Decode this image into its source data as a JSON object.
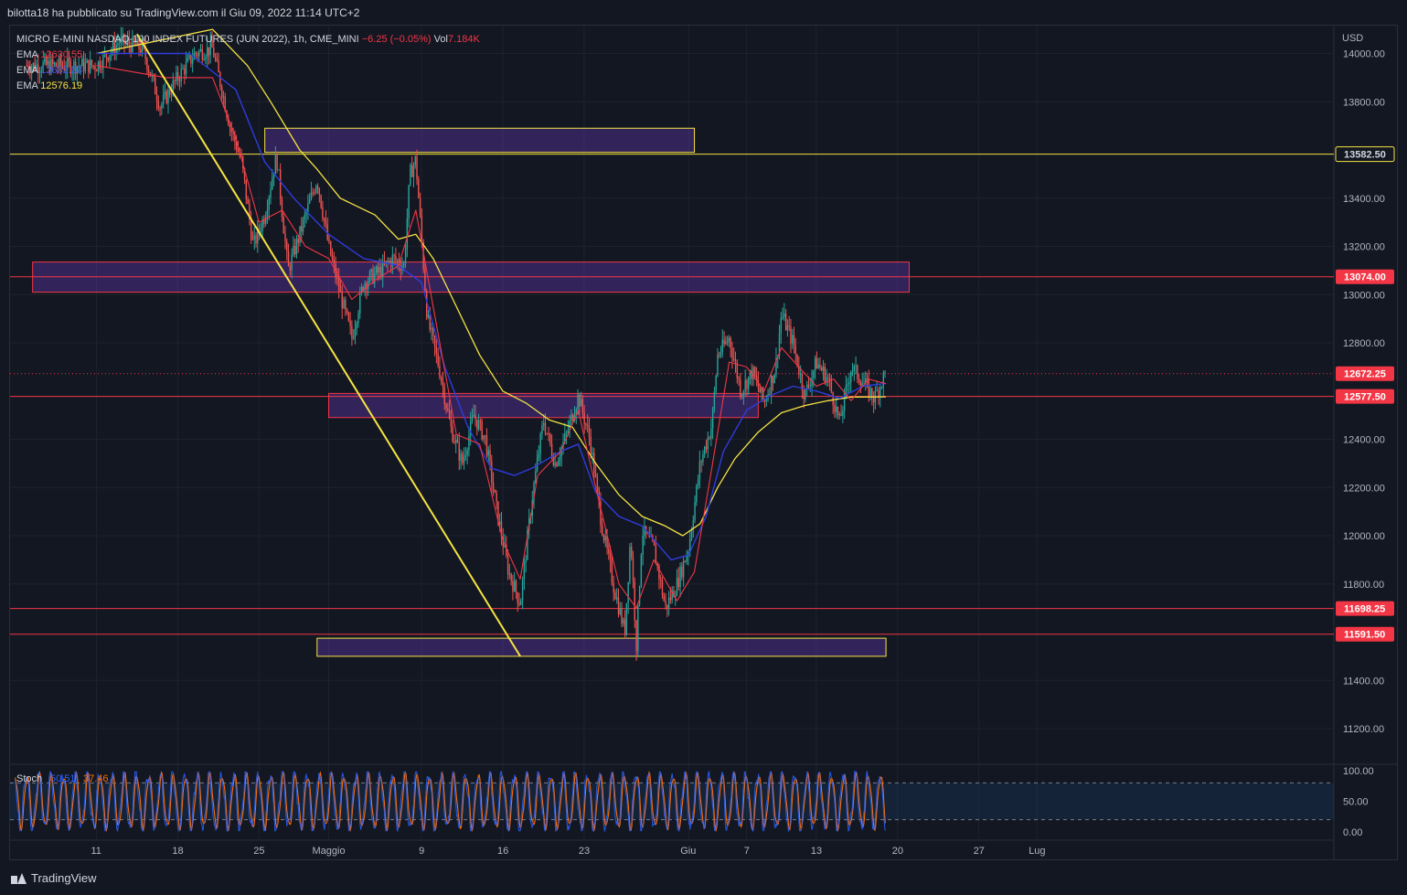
{
  "header": {
    "published_line": "bilotta18 ha pubblicato su TradingView.com il Giu 09, 2022 11:14 UTC+2"
  },
  "legend": {
    "symbol": "MICRO E-MINI NASDAQ-100 INDEX FUTURES (JUN 2022), 1h, CME_MINI",
    "change": "−6.25 (−0.05%)",
    "volume_label": "Vol",
    "volume_value": "7.184K",
    "ema": [
      {
        "label": "EMA",
        "value": "12630.55",
        "color": "#f23645"
      },
      {
        "label": "EMA",
        "value": "12632.03",
        "color": "#2f3cdc"
      },
      {
        "label": "EMA",
        "value": "12576.19",
        "color": "#f5e342"
      }
    ]
  },
  "footer": {
    "brand": "TradingView"
  },
  "chart_data": [
    {
      "type": "candlestick",
      "currency": "USD",
      "ylim": [
        11050,
        14080
      ],
      "yticks": [
        14000,
        13800,
        13400,
        13200,
        13000,
        12800,
        12400,
        12200,
        12000,
        11800,
        11400,
        11200
      ],
      "ytick_labels": [
        "14000.00",
        "13800.00",
        "13400.00",
        "13200.00",
        "13000.00",
        "12800.00",
        "12400.00",
        "12200.00",
        "12000.00",
        "11800.00",
        "11400.00",
        "11200.00"
      ],
      "xticks": [
        {
          "label": "11",
          "pos": 0.0
        },
        {
          "label": "18",
          "pos": 7.0
        },
        {
          "label": "25",
          "pos": 14.0
        },
        {
          "label": "Maggio",
          "pos": 20.0
        },
        {
          "label": "9",
          "pos": 28.0
        },
        {
          "label": "16",
          "pos": 35.0
        },
        {
          "label": "23",
          "pos": 42.0
        },
        {
          "label": "Giu",
          "pos": 51.0
        },
        {
          "label": "7",
          "pos": 56.0
        },
        {
          "label": "13",
          "pos": 62.0
        },
        {
          "label": "20",
          "pos": 69.0
        },
        {
          "label": "27",
          "pos": 76.0
        },
        {
          "label": "Lug",
          "pos": 81.0
        }
      ],
      "price_path": [
        [
          0,
          13950
        ],
        [
          2,
          14050
        ],
        [
          4,
          14020
        ],
        [
          5.5,
          13780
        ],
        [
          7,
          13900
        ],
        [
          8.5,
          14000
        ],
        [
          10,
          14020
        ],
        [
          11.5,
          13700
        ],
        [
          12.5,
          13550
        ],
        [
          13.5,
          13200
        ],
        [
          14.5,
          13330
        ],
        [
          15.5,
          13580
        ],
        [
          16.5,
          13100
        ],
        [
          17.5,
          13250
        ],
        [
          19,
          13480
        ],
        [
          20,
          13200
        ],
        [
          21,
          13000
        ],
        [
          22,
          12820
        ],
        [
          23,
          13050
        ],
        [
          24.5,
          13100
        ],
        [
          25.5,
          13150
        ],
        [
          26.5,
          13120
        ],
        [
          27,
          13500
        ],
        [
          27.5,
          13560
        ],
        [
          28.5,
          12900
        ],
        [
          29.5,
          12700
        ],
        [
          30.5,
          12450
        ],
        [
          31.5,
          12300
        ],
        [
          32.5,
          12500
        ],
        [
          33.5,
          12400
        ],
        [
          34.5,
          12100
        ],
        [
          35.5,
          11850
        ],
        [
          36.5,
          11720
        ],
        [
          37.5,
          12150
        ],
        [
          38.5,
          12480
        ],
        [
          39.5,
          12300
        ],
        [
          40.5,
          12420
        ],
        [
          41.5,
          12580
        ],
        [
          42.5,
          12400
        ],
        [
          43.5,
          12050
        ],
        [
          44.5,
          11800
        ],
        [
          45.5,
          11600
        ],
        [
          46,
          12000
        ],
        [
          46.5,
          11550
        ],
        [
          47,
          12020
        ],
        [
          48,
          11950
        ],
        [
          49,
          11700
        ],
        [
          50,
          11800
        ],
        [
          51,
          11950
        ],
        [
          52,
          12300
        ],
        [
          53,
          12460
        ],
        [
          53.5,
          12750
        ],
        [
          54.5,
          12820
        ],
        [
          55.5,
          12600
        ],
        [
          56.5,
          12680
        ],
        [
          57.5,
          12550
        ],
        [
          58.5,
          12700
        ],
        [
          59,
          12920
        ],
        [
          60,
          12800
        ],
        [
          61,
          12580
        ],
        [
          62,
          12720
        ],
        [
          63,
          12650
        ],
        [
          64,
          12470
        ],
        [
          65,
          12700
        ],
        [
          66,
          12640
        ],
        [
          67,
          12570
        ],
        [
          68,
          12680
        ]
      ],
      "ema_fast": [
        [
          0,
          13950
        ],
        [
          6,
          13900
        ],
        [
          10,
          13900
        ],
        [
          12,
          13650
        ],
        [
          14,
          13300
        ],
        [
          16,
          13350
        ],
        [
          18,
          13200
        ],
        [
          20,
          13150
        ],
        [
          22,
          12980
        ],
        [
          24,
          13060
        ],
        [
          26,
          13120
        ],
        [
          27.5,
          13350
        ],
        [
          29,
          12950
        ],
        [
          31,
          12420
        ],
        [
          33,
          12380
        ],
        [
          35,
          11980
        ],
        [
          36.5,
          11820
        ],
        [
          38,
          12250
        ],
        [
          40,
          12350
        ],
        [
          41.5,
          12520
        ],
        [
          43,
          12200
        ],
        [
          45,
          11800
        ],
        [
          46.5,
          11700
        ],
        [
          48,
          11900
        ],
        [
          50,
          11730
        ],
        [
          51.5,
          11850
        ],
        [
          53,
          12280
        ],
        [
          54.5,
          12720
        ],
        [
          56,
          12700
        ],
        [
          57.5,
          12600
        ],
        [
          59,
          12780
        ],
        [
          60.5,
          12700
        ],
        [
          62,
          12620
        ],
        [
          63.5,
          12650
        ],
        [
          65,
          12560
        ],
        [
          66.5,
          12650
        ],
        [
          68,
          12630
        ]
      ],
      "ema_mid": [
        [
          0,
          14000
        ],
        [
          8,
          14000
        ],
        [
          12,
          13850
        ],
        [
          14.5,
          13550
        ],
        [
          17,
          13400
        ],
        [
          20,
          13250
        ],
        [
          23,
          13150
        ],
        [
          26,
          13120
        ],
        [
          28,
          13050
        ],
        [
          30,
          12700
        ],
        [
          32,
          12450
        ],
        [
          34,
          12280
        ],
        [
          36,
          12250
        ],
        [
          37.5,
          12280
        ],
        [
          40,
          12350
        ],
        [
          41.5,
          12380
        ],
        [
          43,
          12180
        ],
        [
          45,
          12080
        ],
        [
          47,
          12040
        ],
        [
          49.5,
          11900
        ],
        [
          51,
          11920
        ],
        [
          52.5,
          12080
        ],
        [
          54,
          12350
        ],
        [
          56,
          12520
        ],
        [
          58,
          12580
        ],
        [
          60,
          12620
        ],
        [
          62,
          12600
        ],
        [
          64,
          12570
        ],
        [
          66,
          12620
        ],
        [
          68,
          12632
        ]
      ],
      "ema_slow": [
        [
          0,
          14000
        ],
        [
          10,
          14100
        ],
        [
          13,
          13950
        ],
        [
          15,
          13800
        ],
        [
          17.5,
          13600
        ],
        [
          19,
          13520
        ],
        [
          21,
          13400
        ],
        [
          24,
          13330
        ],
        [
          26,
          13230
        ],
        [
          27.5,
          13250
        ],
        [
          29,
          13150
        ],
        [
          31,
          12950
        ],
        [
          33,
          12750
        ],
        [
          35,
          12600
        ],
        [
          37,
          12550
        ],
        [
          39,
          12480
        ],
        [
          41,
          12450
        ],
        [
          43,
          12300
        ],
        [
          45,
          12170
        ],
        [
          47,
          12080
        ],
        [
          49,
          12040
        ],
        [
          50.5,
          12000
        ],
        [
          52,
          12050
        ],
        [
          53.5,
          12200
        ],
        [
          55,
          12320
        ],
        [
          57,
          12430
        ],
        [
          59,
          12510
        ],
        [
          61,
          12540
        ],
        [
          63,
          12560
        ],
        [
          65,
          12575
        ],
        [
          68,
          12576
        ]
      ],
      "horizontal_levels": [
        {
          "value": 13582.5,
          "label": "13582.50",
          "color": "#f5e342"
        },
        {
          "value": 13074.0,
          "label": "13074.00",
          "color": "#f23645"
        },
        {
          "value": 12577.5,
          "label": "12577.50",
          "color": "#f23645"
        },
        {
          "value": 11698.25,
          "label": "11698.25",
          "color": "#f23645"
        },
        {
          "value": 11591.5,
          "label": "11591.50",
          "color": "#f23645"
        }
      ],
      "last_price": {
        "value": 12672.25,
        "label": "12672.25",
        "color": "#f23645"
      },
      "zones": [
        {
          "x1": 14.5,
          "x2": 51.5,
          "y1": 13590,
          "y2": 13690,
          "border": "#f5e342"
        },
        {
          "x1": -5.5,
          "x2": 70.0,
          "y1": 13010,
          "y2": 13135,
          "border": "#f23645"
        },
        {
          "x1": 20.0,
          "x2": 57.0,
          "y1": 12490,
          "y2": 12590,
          "border": "#f23645"
        },
        {
          "x1": 19.0,
          "x2": 68.0,
          "y1": 11500,
          "y2": 11575,
          "border": "#f5e342"
        }
      ],
      "trendline": [
        [
          3.5,
          14080
        ],
        [
          36.5,
          11500
        ]
      ]
    },
    {
      "type": "line",
      "title": "Stoch",
      "k_label": "50.51",
      "d_label": "37.46",
      "k_color": "#2962ff",
      "d_color": "#ff6d00",
      "ylim": [
        -5,
        105
      ],
      "yticks": [
        100,
        50,
        0
      ],
      "ytick_labels": [
        "100.00",
        "50.00",
        "0.00"
      ],
      "bands": [
        80,
        20
      ],
      "cycle_days": 1.05
    }
  ]
}
